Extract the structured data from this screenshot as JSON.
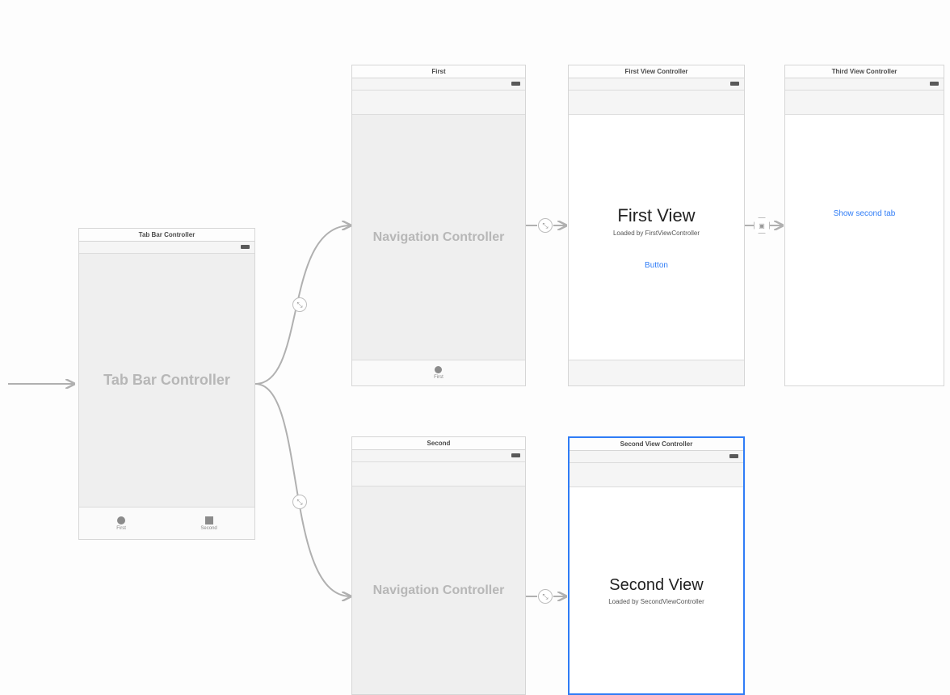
{
  "scenes": {
    "tabBar": {
      "title": "Tab Bar Controller",
      "body": "Tab Bar Controller",
      "tabs": {
        "first": "First",
        "second": "Second"
      }
    },
    "nav1": {
      "title": "First",
      "body": "Navigation Controller",
      "tab_item": "First"
    },
    "nav2": {
      "title": "Second",
      "body": "Navigation Controller"
    },
    "firstVC": {
      "title": "First View Controller",
      "headline": "First View",
      "subline": "Loaded by FirstViewController",
      "button": "Button"
    },
    "secondVC": {
      "title": "Second View Controller",
      "headline": "Second View",
      "subline": "Loaded by SecondViewController"
    },
    "thirdVC": {
      "title": "Third View Controller",
      "link": "Show second tab"
    }
  }
}
